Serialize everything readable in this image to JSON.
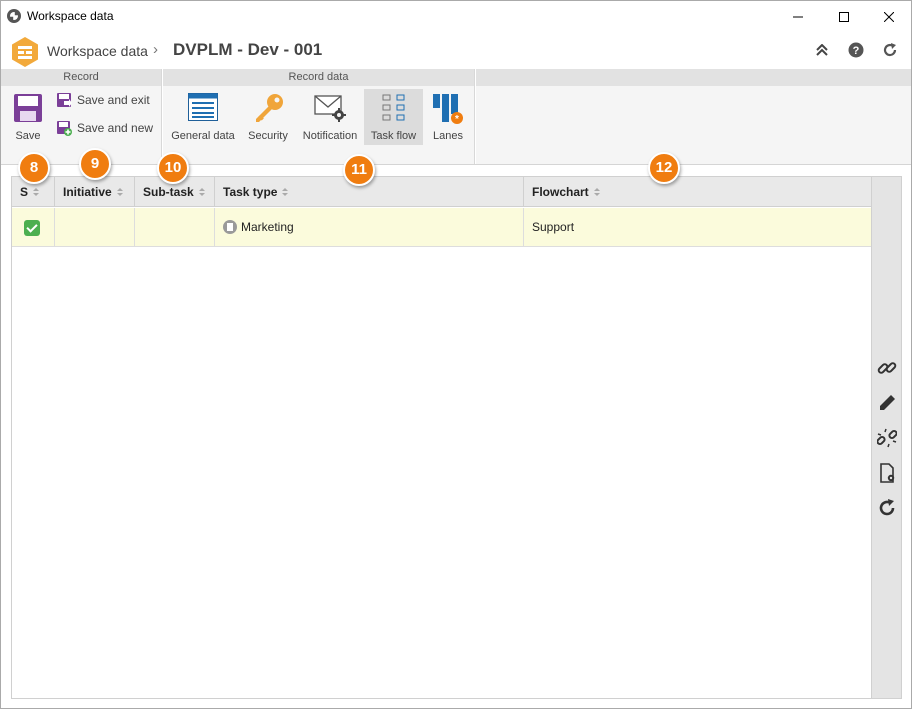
{
  "window": {
    "title": "Workspace data"
  },
  "breadcrumb": {
    "root": "Workspace data",
    "separator": "›",
    "current": "DVPLM - Dev - 001"
  },
  "toolbar": {
    "groups": [
      {
        "label": "Record"
      },
      {
        "label": "Record data"
      }
    ],
    "save": "Save",
    "save_exit": "Save and exit",
    "save_new": "Save and new",
    "general_data": "General data",
    "security": "Security",
    "notification": "Notification",
    "task_flow": "Task flow",
    "lanes": "Lanes"
  },
  "grid": {
    "columns": [
      "S",
      "Initiative",
      "Sub-task",
      "Task type",
      "Flowchart"
    ],
    "rows": [
      {
        "checked": true,
        "initiative": "",
        "subtask": "",
        "task_type": "Marketing",
        "flowchart": "Support"
      }
    ]
  },
  "side_tools": [
    "link-icon",
    "edit-icon",
    "unlink-icon",
    "document-settings-icon",
    "refresh-icon"
  ],
  "callouts": [
    "8",
    "9",
    "10",
    "11",
    "12"
  ],
  "colors": {
    "accent": "#f07d10",
    "selected_row": "#fbfbdc",
    "check": "#4caf50"
  }
}
